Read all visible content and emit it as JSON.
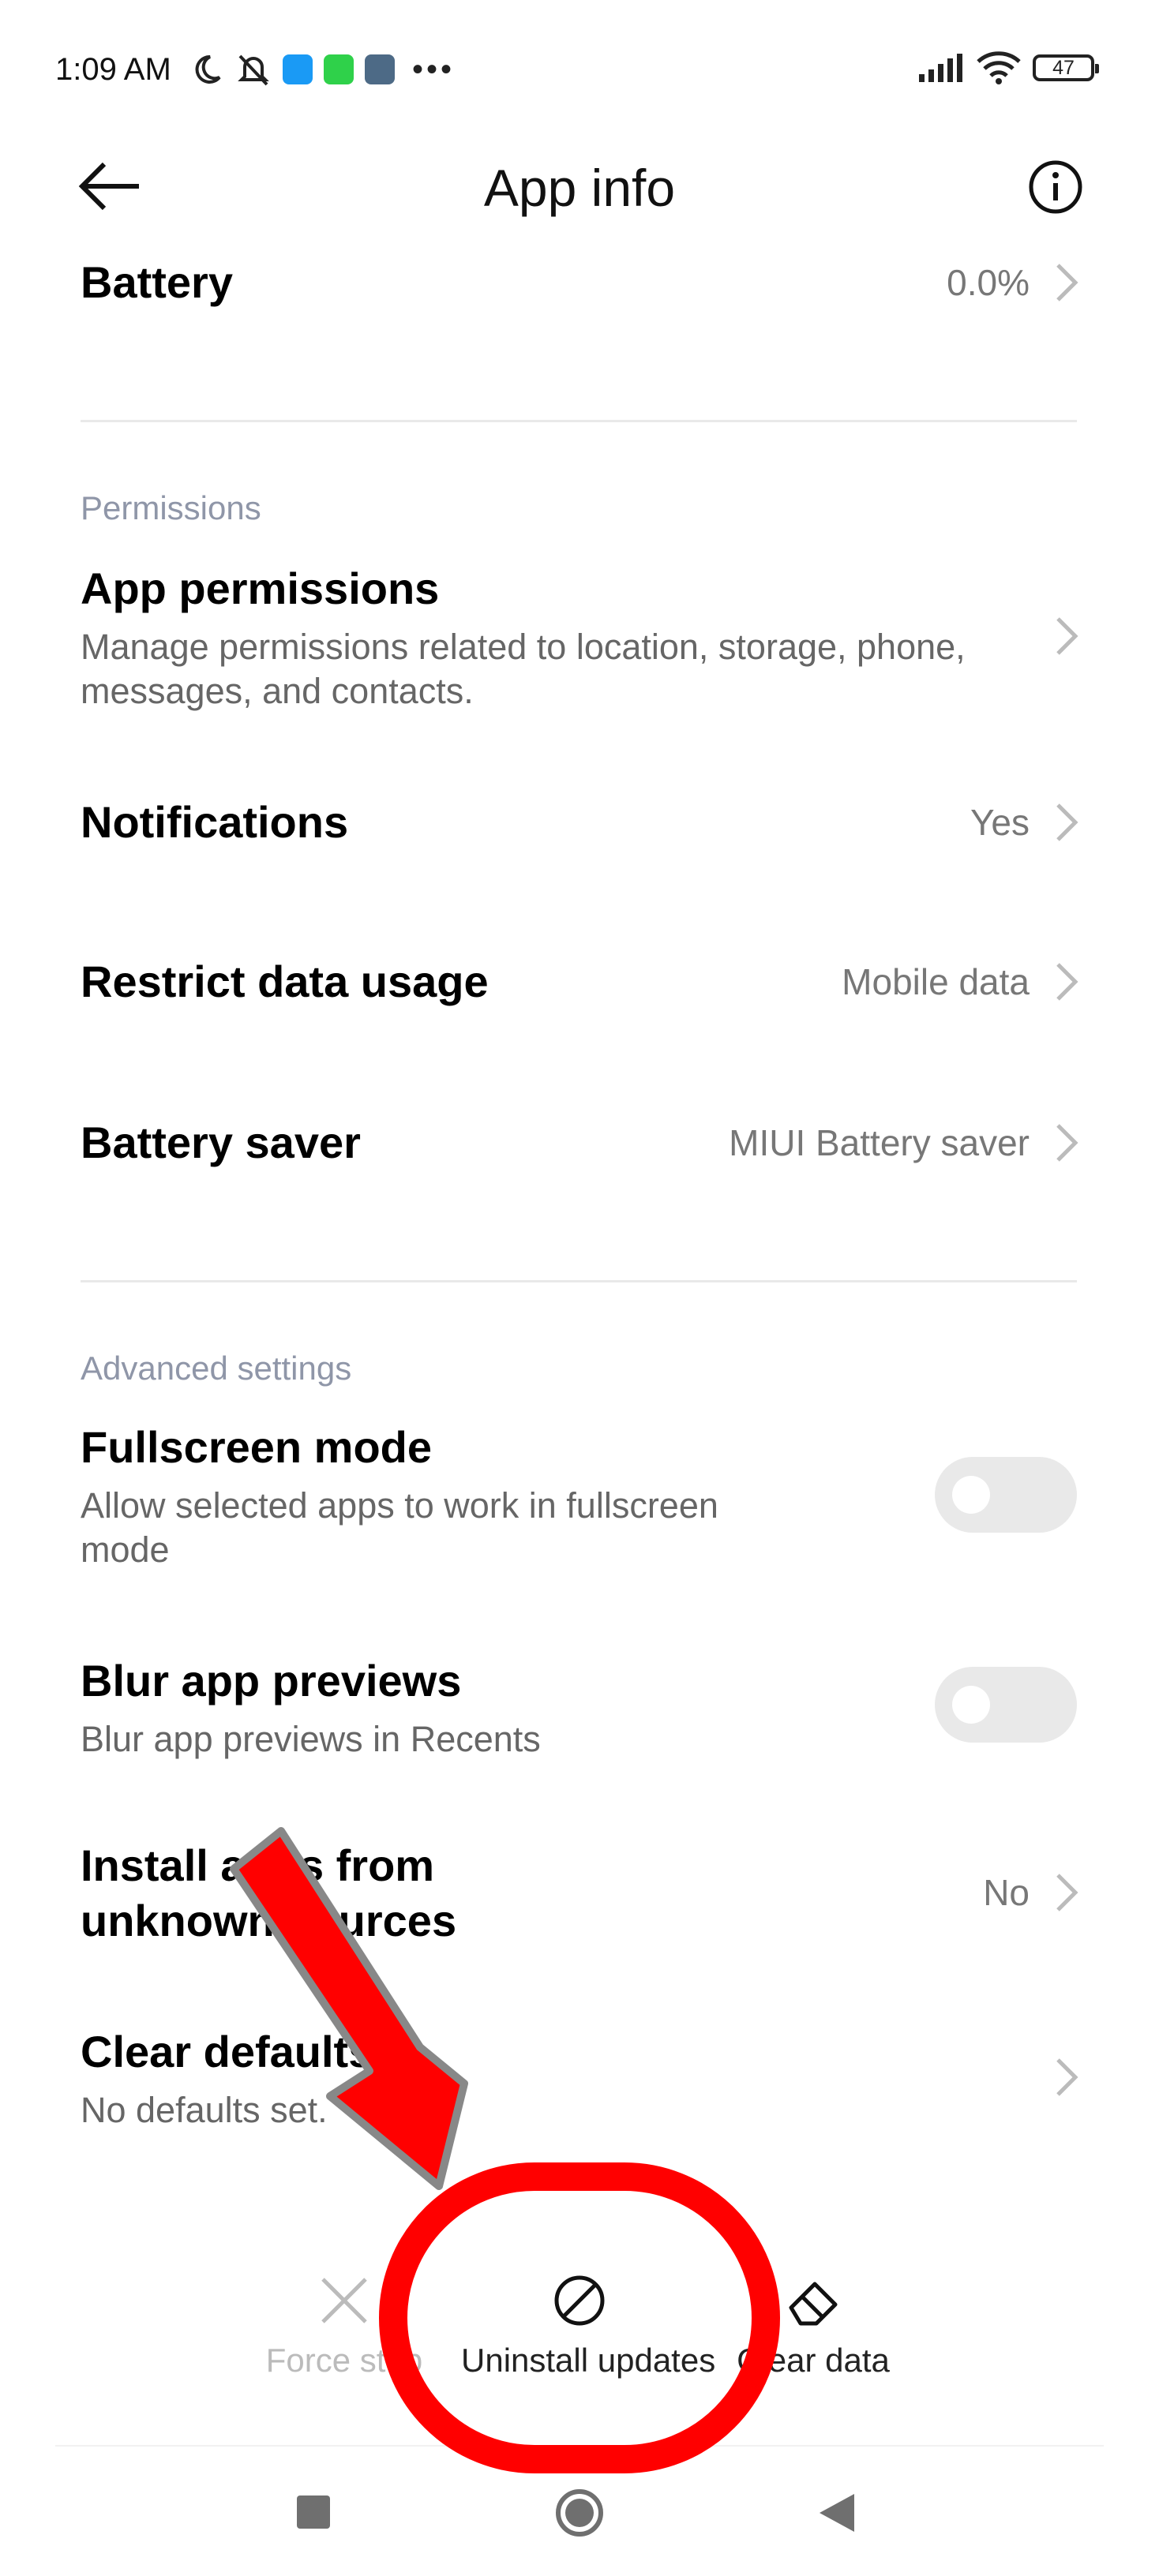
{
  "status_bar": {
    "time": "1:09 AM",
    "battery": "47",
    "notification_icons": [
      "moon-icon",
      "bell-off-icon",
      "messages-app-icon",
      "messenger-app-icon",
      "settings-app-icon",
      "more-dots-icon"
    ]
  },
  "header": {
    "title": "App info"
  },
  "battery_row": {
    "label": "Battery",
    "value": "0.0%"
  },
  "permissions": {
    "section": "Permissions",
    "app_permissions": {
      "label": "App permissions",
      "sub_line1": "Manage permissions related to location, storage, phone,",
      "sub_line2": "messages, and contacts."
    },
    "notifications": {
      "label": "Notifications",
      "value": "Yes"
    },
    "restrict_data": {
      "label": "Restrict data usage",
      "value": "Mobile data"
    },
    "battery_saver": {
      "label": "Battery saver",
      "value": "MIUI Battery saver"
    }
  },
  "advanced": {
    "section": "Advanced settings",
    "fullscreen": {
      "label": "Fullscreen mode",
      "sub_line1": "Allow selected apps to work in fullscreen",
      "sub_line2": "mode",
      "enabled": false
    },
    "blur": {
      "label": "Blur app previews",
      "sub": "Blur app previews in Recents",
      "enabled": false
    },
    "unknown_sources": {
      "label_line1": "Install apps from",
      "label_line2": "unknown sources",
      "value": "No"
    },
    "clear_defaults": {
      "label": "Clear defaults",
      "sub": "No defaults set."
    }
  },
  "bottom_actions": {
    "force_stop": "Force stop",
    "uninstall_updates": "Uninstall updates",
    "clear_data": "Clear data"
  },
  "colors": {
    "annotation_red": "#ff0000",
    "secondary_text": "#777777",
    "section_label": "#8f96a8"
  }
}
